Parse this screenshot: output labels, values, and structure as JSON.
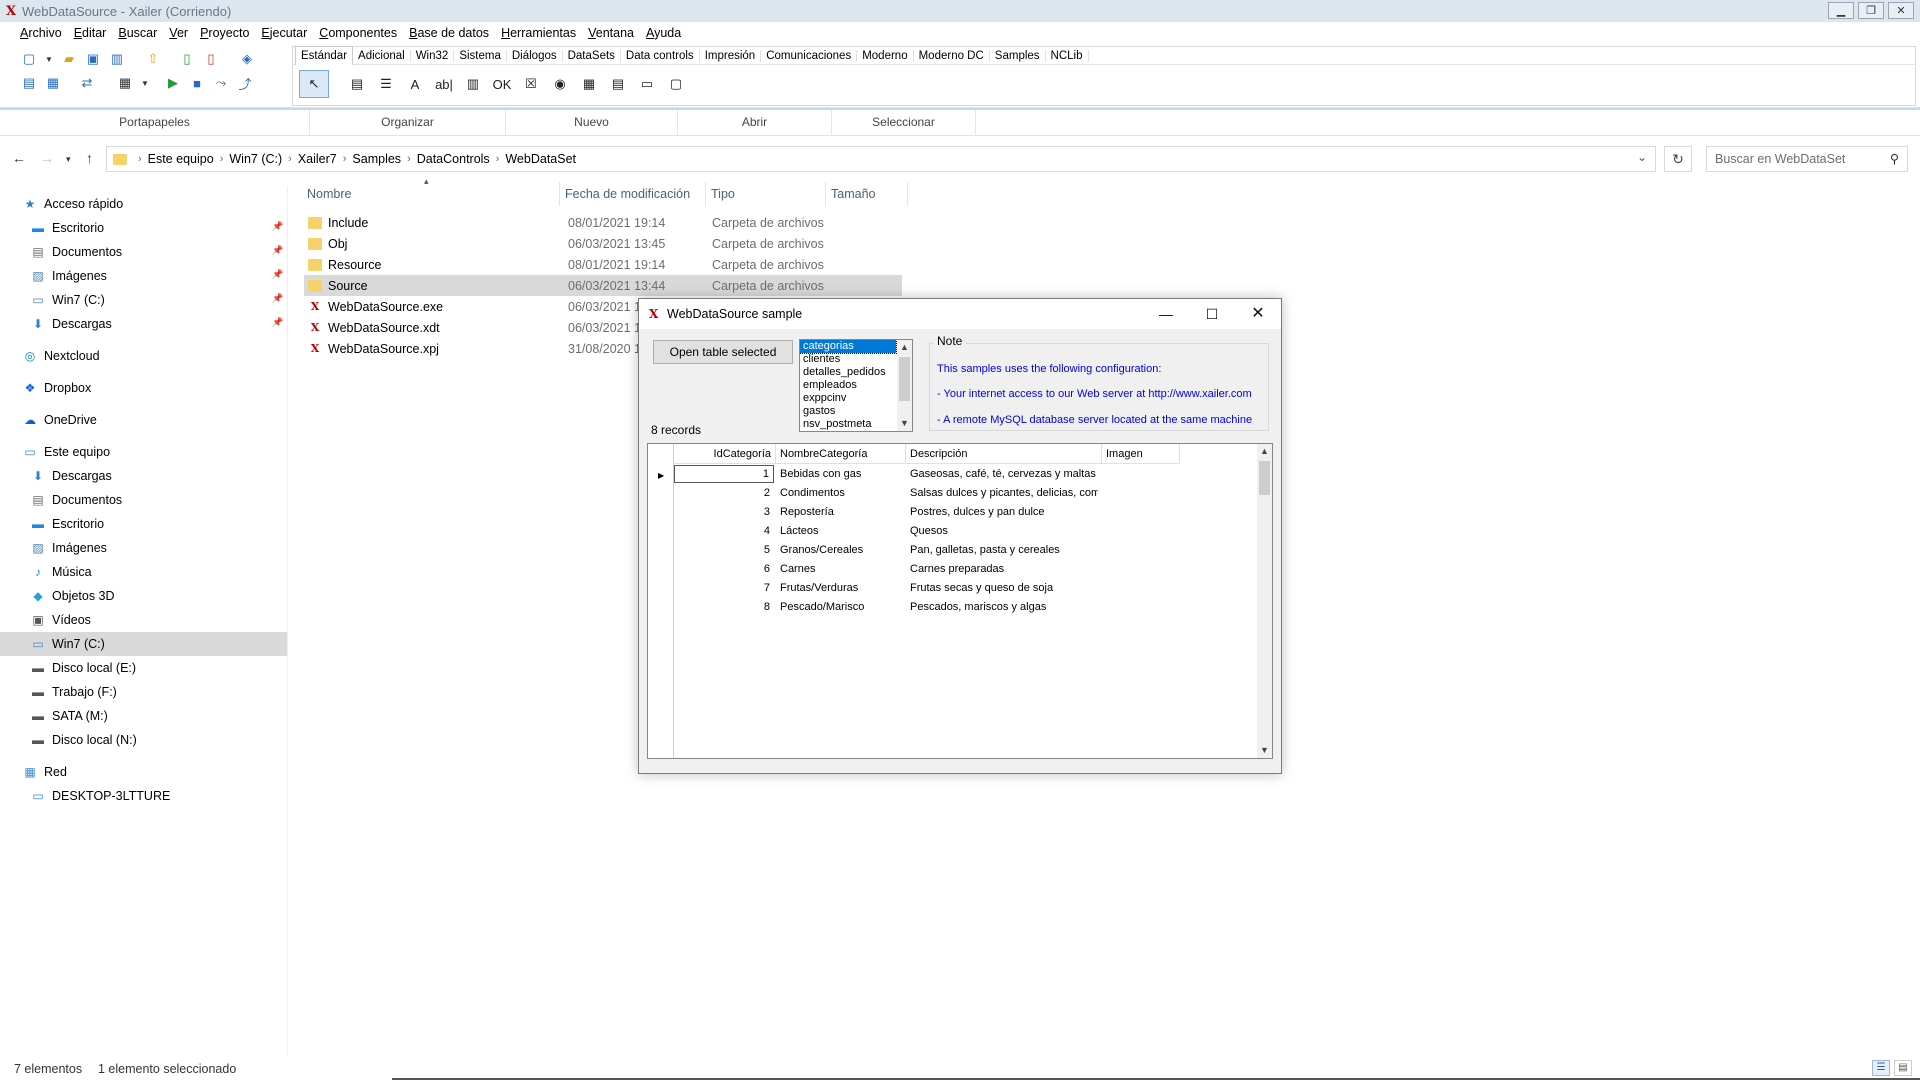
{
  "ide": {
    "title": "WebDataSource - Xailer  (Corriendo)",
    "logo": "X",
    "menu": [
      "Archivo",
      "Editar",
      "Buscar",
      "Ver",
      "Proyecto",
      "Ejecutar",
      "Componentes",
      "Base de datos",
      "Herramientas",
      "Ventana",
      "Ayuda"
    ],
    "palette_tabs": [
      "Estándar",
      "Adicional",
      "Win32",
      "Sistema",
      "Diálogos",
      "DataSets",
      "Data controls",
      "Impresión",
      "Comunicaciones",
      "Moderno",
      "Moderno DC",
      "Samples",
      "NCLib"
    ],
    "palette_active": "Estándar",
    "palette_components": [
      "cursor-arrow",
      "mainmenu",
      "popupmenu",
      "label",
      "edit",
      "memo",
      "button",
      "checkbox",
      "radio",
      "listbox",
      "combobox",
      "scrollbar",
      "panel"
    ],
    "palette_glyphs": [
      "↖",
      "▤",
      "☰",
      "A",
      "ab|",
      "▥",
      "OK",
      "☒",
      "◉",
      "▦",
      "▤",
      "▭",
      "▢"
    ]
  },
  "ribbon": {
    "groups": [
      "Portapapeles",
      "Organizar",
      "Nuevo",
      "Abrir",
      "Seleccionar"
    ]
  },
  "explorer": {
    "breadcrumb": [
      "Este equipo",
      "Win7 (C:)",
      "Xailer7",
      "Samples",
      "DataControls",
      "WebDataSet"
    ],
    "search_placeholder": "Buscar en WebDataSet",
    "columns": [
      "Nombre",
      "Fecha de modificación",
      "Tipo",
      "Tamaño"
    ],
    "files": [
      {
        "name": "Include",
        "date": "08/01/2021 19:14",
        "type": "Carpeta de archivos",
        "kind": "folder"
      },
      {
        "name": "Obj",
        "date": "06/03/2021 13:45",
        "type": "Carpeta de archivos",
        "kind": "folder"
      },
      {
        "name": "Resource",
        "date": "08/01/2021 19:14",
        "type": "Carpeta de archivos",
        "kind": "folder"
      },
      {
        "name": "Source",
        "date": "06/03/2021 13:44",
        "type": "Carpeta de archivos",
        "kind": "folder"
      },
      {
        "name": "WebDataSource.exe",
        "date": "06/03/2021 13",
        "type": "",
        "kind": "xailer"
      },
      {
        "name": "WebDataSource.xdt",
        "date": "06/03/2021 13",
        "type": "",
        "kind": "xailer"
      },
      {
        "name": "WebDataSource.xpj",
        "date": "31/08/2020 1",
        "type": "",
        "kind": "xailer"
      }
    ],
    "selected_file": "Source",
    "sidebar": [
      {
        "label": "Acceso rápido",
        "icon": "star-icon",
        "glyph": "★",
        "color": "#2b7fd4",
        "indent": 0,
        "pinned": false
      },
      {
        "label": "Escritorio",
        "icon": "desktop-icon",
        "glyph": "▬",
        "color": "#1e88e5",
        "indent": 1,
        "pinned": true
      },
      {
        "label": "Documentos",
        "icon": "document-icon",
        "glyph": "▤",
        "color": "#6d6d6d",
        "indent": 1,
        "pinned": true
      },
      {
        "label": "Imágenes",
        "icon": "image-icon",
        "glyph": "▨",
        "color": "#4a86c5",
        "indent": 1,
        "pinned": true
      },
      {
        "label": "Win7 (C:)",
        "icon": "drive-icon",
        "glyph": "▭",
        "color": "#4a86c5",
        "indent": 1,
        "pinned": true
      },
      {
        "label": "Descargas",
        "icon": "download-icon",
        "glyph": "⬇",
        "color": "#2b7fd4",
        "indent": 1,
        "pinned": true
      },
      {
        "label": "Nextcloud",
        "icon": "nextcloud-icon",
        "glyph": "◎",
        "color": "#0082c9",
        "indent": 0,
        "pinned": false
      },
      {
        "label": "Dropbox",
        "icon": "dropbox-icon",
        "glyph": "❖",
        "color": "#0061fe",
        "indent": 0,
        "pinned": false
      },
      {
        "label": "OneDrive",
        "icon": "cloud-icon",
        "glyph": "☁",
        "color": "#0a64c8",
        "indent": 0,
        "pinned": false
      },
      {
        "label": "Este equipo",
        "icon": "computer-icon",
        "glyph": "▭",
        "color": "#3a8ad6",
        "indent": 0,
        "pinned": false
      },
      {
        "label": "Descargas",
        "icon": "download-icon",
        "glyph": "⬇",
        "color": "#2b7fd4",
        "indent": 1,
        "pinned": false
      },
      {
        "label": "Documentos",
        "icon": "document-icon",
        "glyph": "▤",
        "color": "#6d6d6d",
        "indent": 1,
        "pinned": false
      },
      {
        "label": "Escritorio",
        "icon": "desktop-icon",
        "glyph": "▬",
        "color": "#1e88e5",
        "indent": 1,
        "pinned": false
      },
      {
        "label": "Imágenes",
        "icon": "image-icon",
        "glyph": "▨",
        "color": "#4a86c5",
        "indent": 1,
        "pinned": false
      },
      {
        "label": "Música",
        "icon": "music-icon",
        "glyph": "♪",
        "color": "#2b7fd4",
        "indent": 1,
        "pinned": false
      },
      {
        "label": "Objetos 3D",
        "icon": "cube-icon",
        "glyph": "◆",
        "color": "#26a0da",
        "indent": 1,
        "pinned": false
      },
      {
        "label": "Vídeos",
        "icon": "video-icon",
        "glyph": "▣",
        "color": "#555555",
        "indent": 1,
        "pinned": false
      },
      {
        "label": "Win7 (C:)",
        "icon": "drive-icon",
        "glyph": "▭",
        "color": "#4a86c5",
        "indent": 1,
        "pinned": false
      },
      {
        "label": "Disco local (E:)",
        "icon": "drive-icon",
        "glyph": "▬",
        "color": "#555555",
        "indent": 1,
        "pinned": false
      },
      {
        "label": "Trabajo (F:)",
        "icon": "drive-icon",
        "glyph": "▬",
        "color": "#555555",
        "indent": 1,
        "pinned": false
      },
      {
        "label": "SATA (M:)",
        "icon": "drive-icon",
        "glyph": "▬",
        "color": "#555555",
        "indent": 1,
        "pinned": false
      },
      {
        "label": "Disco local (N:)",
        "icon": "drive-icon",
        "glyph": "▬",
        "color": "#555555",
        "indent": 1,
        "pinned": false
      },
      {
        "label": "Red",
        "icon": "network-icon",
        "glyph": "▦",
        "color": "#3a8ad6",
        "indent": 0,
        "pinned": false
      },
      {
        "label": "DESKTOP-3LTTURE",
        "icon": "computer-icon",
        "glyph": "▭",
        "color": "#3a8ad6",
        "indent": 1,
        "pinned": false
      }
    ],
    "sidebar_selected": "Win7 (C:)",
    "status_count": "7 elementos",
    "status_selection": "1 elemento seleccionado"
  },
  "dialog": {
    "title": "WebDataSource sample",
    "logo": "X",
    "open_button": "Open table selected",
    "records_label": "8 records",
    "tables": [
      "categorias",
      "clientes",
      "detalles_pedidos",
      "empleados",
      "exppcinv",
      "gastos",
      "nsv_postmeta"
    ],
    "selected_table": "categorias",
    "note_title": "Note",
    "note_lines": [
      "This samples uses the following configuration:",
      "- Your internet access to our Web server at http://www.xailer.com",
      "- A remote MySQL database server located at the same machine"
    ],
    "grid_columns": [
      "IdCategoría",
      "NombreCategoría",
      "Descripción",
      "Imagen"
    ],
    "grid_rows": [
      {
        "id": "1",
        "name": "Bebidas con gas",
        "desc": "Gaseosas, café, té, cervezas y maltas"
      },
      {
        "id": "2",
        "name": "Condimentos",
        "desc": "Salsas dulces y picantes, delicias, comi"
      },
      {
        "id": "3",
        "name": "Repostería",
        "desc": "Postres, dulces y pan dulce"
      },
      {
        "id": "4",
        "name": "Lácteos",
        "desc": "Quesos"
      },
      {
        "id": "5",
        "name": "Granos/Cereales",
        "desc": "Pan, galletas, pasta y cereales"
      },
      {
        "id": "6",
        "name": "Carnes",
        "desc": "Carnes preparadas"
      },
      {
        "id": "7",
        "name": "Frutas/Verduras",
        "desc": "Frutas secas y queso de soja"
      },
      {
        "id": "8",
        "name": "Pescado/Marisco",
        "desc": "Pescados, mariscos y algas"
      }
    ],
    "current_row": 1
  }
}
